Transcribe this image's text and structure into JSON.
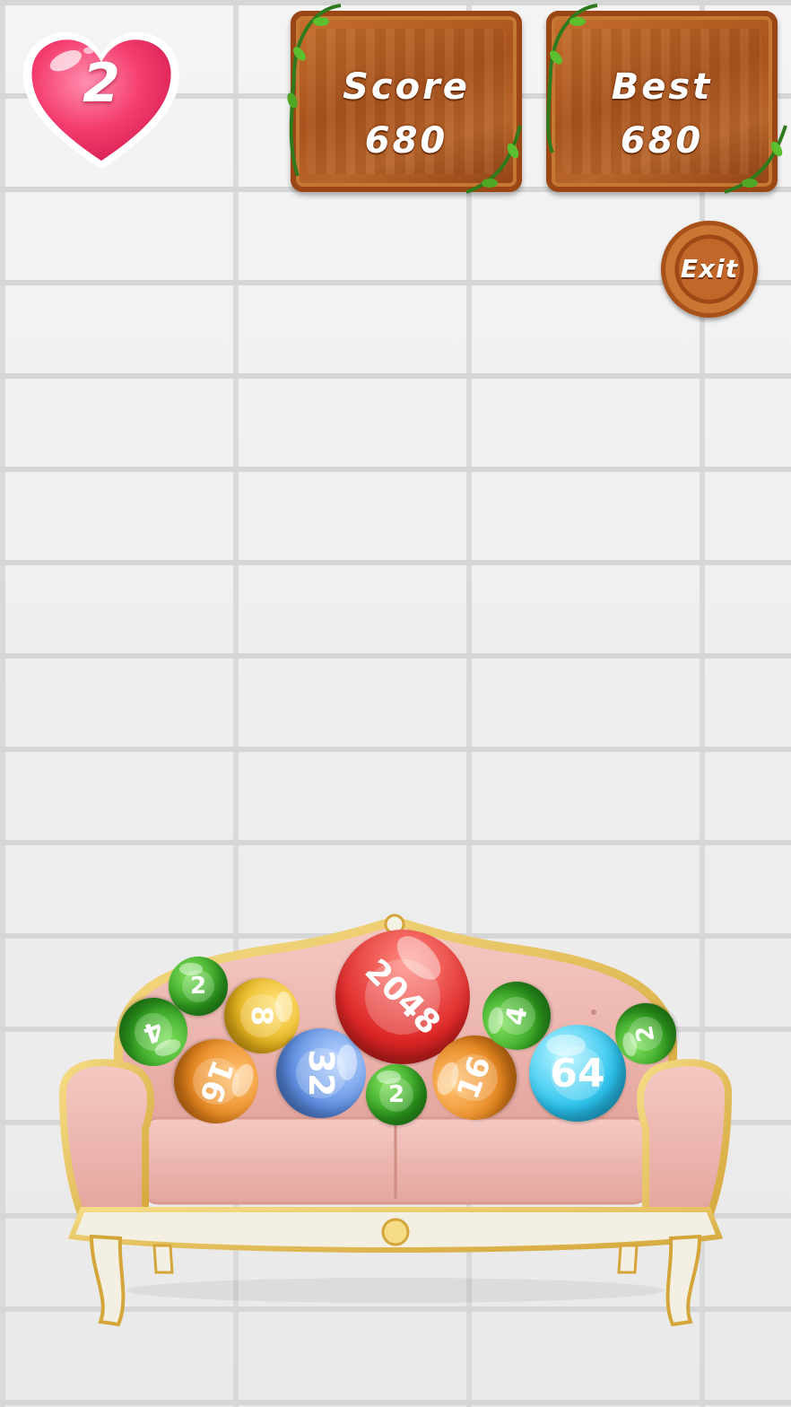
{
  "hud": {
    "lives": "2",
    "score_label": "Score",
    "score_value": "680",
    "best_label": "Best",
    "best_value": "680",
    "exit_label": "Exit"
  },
  "balls": [
    {
      "value": "2",
      "color": "green"
    },
    {
      "value": "4",
      "color": "green"
    },
    {
      "value": "8",
      "color": "yellow"
    },
    {
      "value": "16",
      "color": "orange"
    },
    {
      "value": "32",
      "color": "blue"
    },
    {
      "value": "2048",
      "color": "red"
    },
    {
      "value": "2",
      "color": "green"
    },
    {
      "value": "16",
      "color": "orange"
    },
    {
      "value": "4",
      "color": "green"
    },
    {
      "value": "64",
      "color": "cyan"
    },
    {
      "value": "2",
      "color": "green"
    }
  ]
}
